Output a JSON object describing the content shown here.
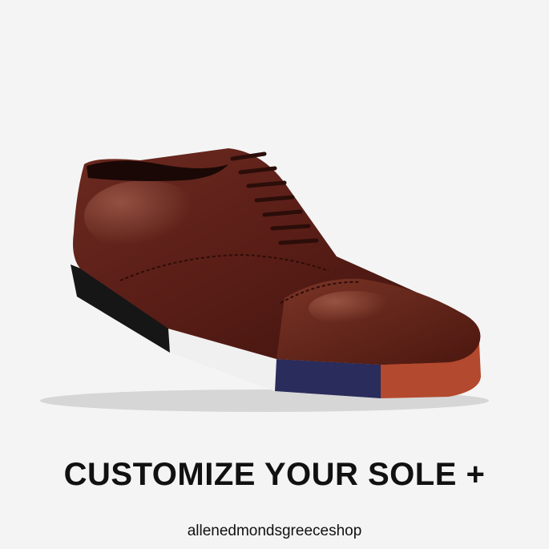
{
  "headline": "CUSTOMIZE YOUR SOLE +",
  "shop_name": "allenedmondsgreeceshop",
  "product": {
    "description_icon": "oxford-shoe-icon",
    "sole_colors": [
      "#1a1a1a",
      "#f2f2f2",
      "#2a2c5c",
      "#b3492e"
    ],
    "leather_color": "#5a1e17"
  }
}
